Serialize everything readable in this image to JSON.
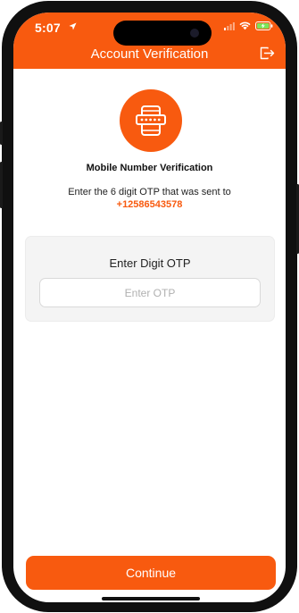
{
  "status_bar": {
    "time": "5:07"
  },
  "header": {
    "title": "Account Verification",
    "logout_icon": "logout-icon"
  },
  "hero": {
    "icon": "password-phone-icon",
    "accent": "#F85A0F"
  },
  "verification": {
    "title": "Mobile Number Verification",
    "description": "Enter the 6 digit OTP that was sent to",
    "phone": "+12586543578"
  },
  "otp": {
    "label": "Enter Digit OTP",
    "value": "",
    "placeholder": "Enter OTP"
  },
  "footer": {
    "continue_label": "Continue"
  },
  "colors": {
    "accent": "#F85A0F",
    "background": "#ffffff",
    "card": "#f4f4f4"
  }
}
